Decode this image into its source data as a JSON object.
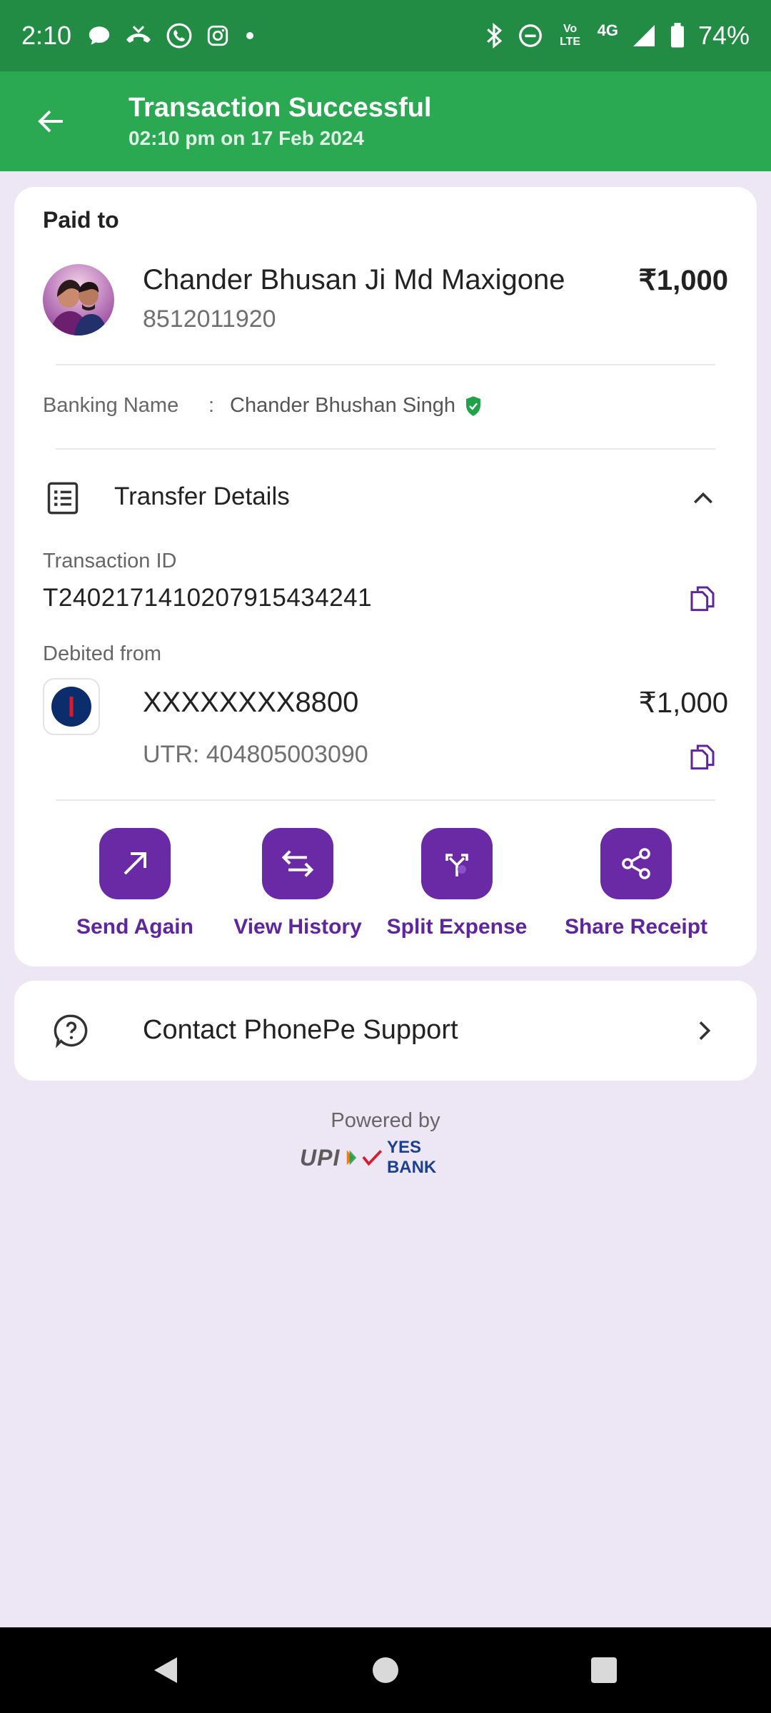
{
  "status_bar": {
    "time": "2:10",
    "network_top": "Vo LTE",
    "network_type": "4G",
    "battery": "74%",
    "icons_left": [
      "message-icon",
      "missed-call-icon",
      "whatsapp-icon",
      "instagram-icon",
      "dot-icon"
    ],
    "icons_right": [
      "bluetooth-icon",
      "dnd-icon",
      "volte-icon",
      "signal-icon",
      "battery-icon"
    ]
  },
  "header": {
    "title": "Transaction Successful",
    "subtitle": "02:10 pm on 17 Feb 2024",
    "background": "#2aa852"
  },
  "payment": {
    "paid_to_label": "Paid to",
    "payee_name": "Chander Bhusan Ji Md Maxigone",
    "payee_phone": "8512011920",
    "amount": "₹1,000",
    "banking_name_label": "Banking Name",
    "banking_name_separator": ":",
    "banking_name_value": "Chander Bhushan Singh"
  },
  "transfer": {
    "section_title": "Transfer Details",
    "txn_id_label": "Transaction ID",
    "txn_id": "T2402171410207915434241",
    "debited_from_label": "Debited from",
    "account_number": "XXXXXXXX8800",
    "debited_amount": "₹1,000",
    "utr": "UTR: 404805003090"
  },
  "actions": [
    {
      "label": "Send Again",
      "icon": "arrow-up-right-icon"
    },
    {
      "label": "View History",
      "icon": "swap-arrows-icon"
    },
    {
      "label": "Split Expense",
      "icon": "split-icon"
    },
    {
      "label": "Share Receipt",
      "icon": "share-icon"
    }
  ],
  "support": {
    "label": "Contact PhonePe Support"
  },
  "footer": {
    "powered_by": "Powered by",
    "upi": "UPI",
    "bank": "YES BANK"
  },
  "colors": {
    "accent": "#5f259f",
    "success": "#2aa852",
    "background": "#ede6f5"
  }
}
